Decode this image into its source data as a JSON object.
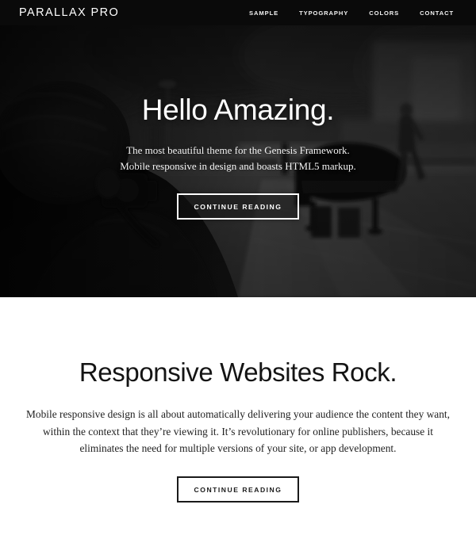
{
  "header": {
    "site_title": "PARALLAX PRO",
    "nav": [
      {
        "label": "SAMPLE"
      },
      {
        "label": "TYPOGRAPHY"
      },
      {
        "label": "COLORS"
      },
      {
        "label": "CONTACT"
      }
    ]
  },
  "hero": {
    "title": "Hello Amazing.",
    "subtitle_line1": "The most beautiful theme for the Genesis Framework.",
    "subtitle_line2": "Mobile responsive in design and boasts HTML5 markup.",
    "button_label": "CONTINUE READING",
    "image_description": "black-and-white photo of a photographer shooting a grand piano on a plaza with a walking figure"
  },
  "content": {
    "title": "Responsive Websites Rock.",
    "paragraph": "Mobile responsive design is all about automatically delivering your audience the content they want, within the context that they’re viewing it. It’s revolutionary for online publishers, because it eliminates the need for multiple versions of your site, or app development.",
    "button_label": "CONTINUE READING"
  },
  "colors": {
    "header_background": "#0a0a0a",
    "page_background": "#ffffff",
    "hero_overlay": "#000000",
    "text_light": "#ffffff",
    "text_dark": "#141414"
  }
}
